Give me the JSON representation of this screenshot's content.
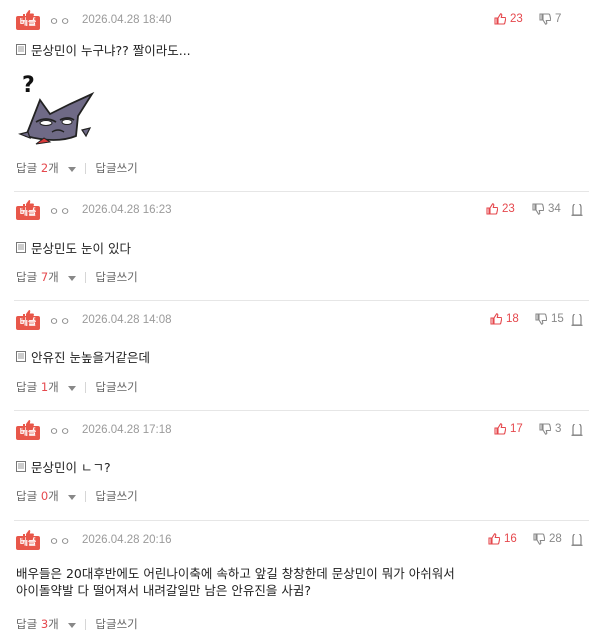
{
  "badge_label": "베플",
  "labels": {
    "reply_prefix": "답글",
    "reply_suffix": "개",
    "write_reply": "답글쓰기"
  },
  "colors": {
    "badge": "#e8574a",
    "like": "#e5484d",
    "reply_count": "#e5484d",
    "divider": "#e6e6e6"
  },
  "comments": [
    {
      "nick": "ㅇㅇ",
      "date": "2026.04.28 18:40",
      "likes": "23",
      "dislikes": "7",
      "show_report": false,
      "text": "문상민이 누구냐?? 짤이라도...",
      "has_sticker": true,
      "sticker_icon": "question-cat-sticker",
      "reply_count": "2"
    },
    {
      "nick": "ㅇㅇ",
      "date": "2026.04.28 16:23",
      "likes": "23",
      "dislikes": "34",
      "show_report": true,
      "text": "문상민도 눈이 있다",
      "reply_count": "7"
    },
    {
      "nick": "ㅇㅇ",
      "date": "2026.04.28 14:08",
      "likes": "18",
      "dislikes": "15",
      "show_report": true,
      "text": "안유진 눈높을거같은데",
      "reply_count": "1"
    },
    {
      "nick": "ㅇㅇ",
      "date": "2026.04.28 17:18",
      "likes": "17",
      "dislikes": "3",
      "show_report": true,
      "text": "문상민이 ㄴㄱ?",
      "reply_count": "0"
    },
    {
      "nick": "ㅇㅇ",
      "date": "2026.04.28 20:16",
      "likes": "16",
      "dislikes": "28",
      "show_report": true,
      "text_lines": [
        "배우들은 20대후반에도 어린나이축에 속하고 앞길 창창한데 문상민이 뭐가 아쉬워서",
        "아이돌약발 다 떨어져서 내려갈일만 남은 안유진을 사귐?"
      ],
      "reply_count": "3"
    }
  ]
}
